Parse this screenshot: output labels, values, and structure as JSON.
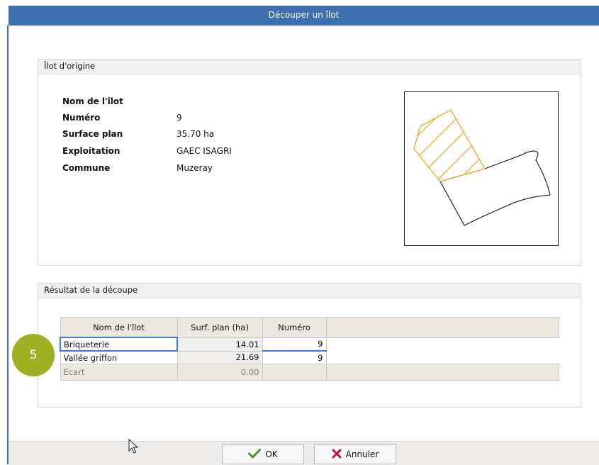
{
  "window": {
    "title": "Découper un îlot"
  },
  "origin": {
    "header": "Îlot d'origine",
    "fields": [
      {
        "label": "Nom de l'îlot",
        "value": ""
      },
      {
        "label": "Numéro",
        "value": "9"
      },
      {
        "label": "Surface plan",
        "value": "35.70 ha"
      },
      {
        "label": "Exploitation",
        "value": "GAEC ISAGRI"
      },
      {
        "label": "Commune",
        "value": "Muzeray"
      }
    ]
  },
  "result": {
    "header": "Résultat de la découpe",
    "columns": [
      "Nom de l'îlot",
      "Surf. plan (ha)",
      "Numéro"
    ],
    "rows": [
      {
        "name": "Briqueterie",
        "surface": "14.01",
        "numero": "9"
      },
      {
        "name": "Vallée griffon",
        "surface": "21.69",
        "numero": "9"
      }
    ],
    "ecart": {
      "label": "Ecart",
      "value": "0.00"
    }
  },
  "badge": "5",
  "buttons": {
    "ok": "OK",
    "cancel": "Annuler"
  },
  "colors": {
    "titlebar": "#3d6fae",
    "badge": "#9fb123",
    "selection": "#3b78d8",
    "hatch": "#f5a623"
  },
  "icons": {
    "ok": "check-icon",
    "cancel": "x-icon",
    "cursor": "mouse-pointer-icon"
  }
}
